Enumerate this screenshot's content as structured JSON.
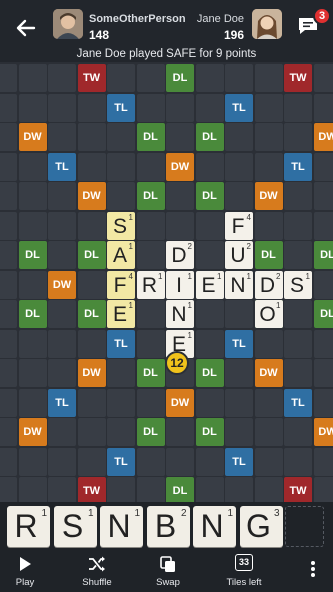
{
  "header": {
    "player1": {
      "name": "SomeOtherPerson",
      "score": "148"
    },
    "player2": {
      "name": "Jane Doe",
      "score": "196"
    },
    "chat_badge": "3",
    "last_move": "Jane Doe played SAFE for 9 points"
  },
  "colors": {
    "TW": "#a0282b",
    "DW": "#d77b1d",
    "TL": "#2f6fa3",
    "DL": "#4a8a3b",
    "empty": "#383d45",
    "tile": "#f4f1ea",
    "highlight": "#f2e8a4",
    "badge": "#e03030",
    "score_bubble": "#f0c21b"
  },
  "board": {
    "premiums": [
      [
        "",
        "",
        "",
        "TW",
        "",
        "",
        "DL",
        "",
        "",
        "",
        "TW",
        "",
        ""
      ],
      [
        "",
        "",
        "",
        "",
        "TL",
        "",
        "",
        "",
        "TL",
        "",
        "",
        "",
        ""
      ],
      [
        "",
        "DW",
        "",
        "",
        "",
        "DL",
        "",
        "DL",
        "",
        "",
        "",
        "DW",
        ""
      ],
      [
        "",
        "",
        "TL",
        "",
        "",
        "",
        "DW",
        "",
        "",
        "",
        "TL",
        "",
        ""
      ],
      [
        "",
        "",
        "",
        "DW",
        "",
        "DL",
        "",
        "DL",
        "",
        "DW",
        "",
        "",
        ""
      ],
      [
        "",
        "",
        "",
        "",
        "",
        "",
        "",
        "",
        "",
        "",
        "",
        "",
        ""
      ],
      [
        "",
        "DL",
        "",
        "DL",
        "",
        "",
        "",
        "",
        "",
        "DL",
        "",
        "DL",
        ""
      ],
      [
        "",
        "",
        "DW",
        "",
        "",
        "",
        "",
        "",
        "",
        "",
        "",
        "",
        ""
      ],
      [
        "",
        "DL",
        "",
        "DL",
        "",
        "",
        "",
        "",
        "",
        "DL",
        "",
        "DL",
        ""
      ],
      [
        "",
        "",
        "",
        "",
        "TL",
        "",
        "",
        "",
        "TL",
        "",
        "",
        "",
        ""
      ],
      [
        "",
        "",
        "",
        "DW",
        "",
        "DL",
        "",
        "DL",
        "",
        "DW",
        "",
        "",
        ""
      ],
      [
        "",
        "",
        "TL",
        "",
        "",
        "",
        "DW",
        "",
        "",
        "",
        "TL",
        "",
        ""
      ],
      [
        "",
        "DW",
        "",
        "",
        "",
        "DL",
        "",
        "DL",
        "",
        "",
        "",
        "DW",
        ""
      ],
      [
        "",
        "",
        "",
        "",
        "TL",
        "",
        "",
        "",
        "TL",
        "",
        "",
        "",
        ""
      ],
      [
        "",
        "",
        "",
        "TW",
        "",
        "",
        "DL",
        "",
        "",
        "",
        "TW",
        "",
        ""
      ]
    ],
    "tiles": [
      {
        "row": 5,
        "col": 4,
        "letter": "S",
        "score": "1",
        "highlight": true
      },
      {
        "row": 6,
        "col": 4,
        "letter": "A",
        "score": "1",
        "highlight": true
      },
      {
        "row": 7,
        "col": 4,
        "letter": "F",
        "score": "4",
        "highlight": true
      },
      {
        "row": 8,
        "col": 4,
        "letter": "E",
        "score": "1",
        "highlight": true
      },
      {
        "row": 5,
        "col": 8,
        "letter": "F",
        "score": "4",
        "highlight": false
      },
      {
        "row": 6,
        "col": 8,
        "letter": "U",
        "score": "2",
        "highlight": false
      },
      {
        "row": 6,
        "col": 6,
        "letter": "D",
        "score": "2",
        "highlight": false
      },
      {
        "row": 7,
        "col": 5,
        "letter": "R",
        "score": "1",
        "highlight": false
      },
      {
        "row": 7,
        "col": 6,
        "letter": "I",
        "score": "1",
        "highlight": false
      },
      {
        "row": 7,
        "col": 7,
        "letter": "E",
        "score": "1",
        "highlight": false
      },
      {
        "row": 7,
        "col": 8,
        "letter": "N",
        "score": "1",
        "highlight": false
      },
      {
        "row": 7,
        "col": 9,
        "letter": "D",
        "score": "2",
        "highlight": false
      },
      {
        "row": 7,
        "col": 10,
        "letter": "S",
        "score": "1",
        "highlight": false
      },
      {
        "row": 8,
        "col": 6,
        "letter": "N",
        "score": "1",
        "highlight": false
      },
      {
        "row": 8,
        "col": 9,
        "letter": "O",
        "score": "1",
        "highlight": false
      },
      {
        "row": 9,
        "col": 6,
        "letter": "E",
        "score": "1",
        "highlight": false
      }
    ],
    "score_bubble": "12"
  },
  "rack": [
    {
      "letter": "R",
      "score": "1"
    },
    {
      "letter": "S",
      "score": "1"
    },
    {
      "letter": "N",
      "score": "1"
    },
    {
      "letter": "B",
      "score": "2"
    },
    {
      "letter": "N",
      "score": "1"
    },
    {
      "letter": "G",
      "score": "3"
    }
  ],
  "toolbar": {
    "play": "Play",
    "shuffle": "Shuffle",
    "swap": "Swap",
    "tiles_left": "Tiles left",
    "tiles_left_count": "33"
  }
}
